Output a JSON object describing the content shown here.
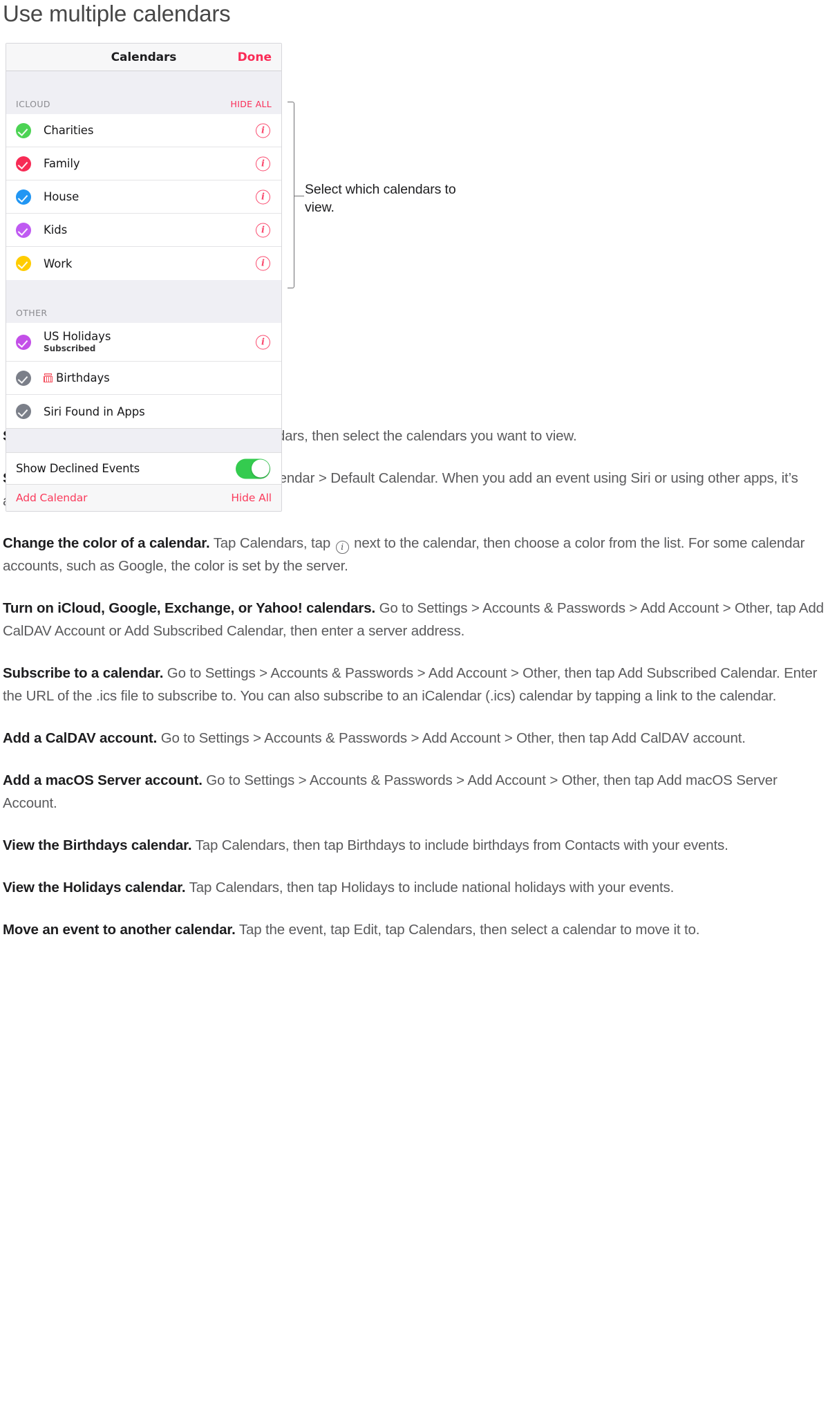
{
  "page": {
    "title": "Use multiple calendars"
  },
  "figure": {
    "callout": "Select which calendars to view.",
    "panel": {
      "navbar": {
        "title": "Calendars",
        "done_label": "Done"
      },
      "sections": [
        {
          "header": "ICLOUD",
          "action_label": "HIDE ALL",
          "rows": [
            {
              "label": "Charities",
              "checked": true,
              "color": "#4cd354",
              "info": true
            },
            {
              "label": "Family",
              "checked": true,
              "color": "#f72b55",
              "info": true
            },
            {
              "label": "House",
              "checked": true,
              "color": "#2196f3",
              "info": true
            },
            {
              "label": "Kids",
              "checked": true,
              "color": "#bf5af2",
              "info": true
            },
            {
              "label": "Work",
              "checked": true,
              "color": "#ffcc00",
              "info": true
            }
          ]
        },
        {
          "header": "OTHER",
          "action_label": "",
          "rows": [
            {
              "label": "US Holidays",
              "sublabel": "Subscribed",
              "checked": true,
              "color": "#c34fe8",
              "info": true
            },
            {
              "label": "Birthdays",
              "checked": true,
              "color": "#7b7f89",
              "info": false,
              "icon": "birthday-cake-icon"
            },
            {
              "label": "Siri Found in Apps",
              "checked": true,
              "color": "#7b7f89",
              "info": false
            }
          ]
        }
      ],
      "toggle_row": {
        "label": "Show Declined Events",
        "state": "on",
        "on_color": "#34cb4f"
      },
      "footer": {
        "add_label": "Add Calendar",
        "hide_label": "Hide All",
        "color": "#fa3b5c"
      }
    }
  },
  "tips": [
    {
      "heading": "See multiple calendars at once.",
      "body_before": " Tap Calendars, then select the calendars you want to view.",
      "has_info_icon": false,
      "body_after": ""
    },
    {
      "heading": "Set a default calendar.",
      "body_before": " Go to Settings > Calendar > Default Calendar. When you add an event using Siri or using other apps, it’s added to your default calendar.",
      "has_info_icon": false,
      "body_after": ""
    },
    {
      "heading": "Change the color of a calendar.",
      "body_before": " Tap Calendars, tap ",
      "has_info_icon": true,
      "body_after": " next to the calendar, then choose a color from the list. For some calendar accounts, such as Google, the color is set by the server."
    },
    {
      "heading": "Turn on iCloud, Google, Exchange, or Yahoo! calendars.",
      "body_before": " Go to Settings > Accounts & Passwords > Add Account > Other, tap Add CalDAV Account or Add Subscribed Calendar, then enter a server address.",
      "has_info_icon": false,
      "body_after": ""
    },
    {
      "heading": "Subscribe to a calendar.",
      "body_before": " Go to Settings > Accounts & Passwords > Add Account > Other, then tap Add Subscribed Calendar. Enter the URL of the .ics file to subscribe to. You can also subscribe to an iCalendar (.ics) calendar by tapping a link to the calendar.",
      "has_info_icon": false,
      "body_after": ""
    },
    {
      "heading": "Add a CalDAV account.",
      "body_before": " Go to Settings > Accounts & Passwords > Add Account > Other, then tap Add CalDAV account.",
      "has_info_icon": false,
      "body_after": ""
    },
    {
      "heading": "Add a macOS Server account.",
      "body_before": " Go to Settings > Accounts & Passwords > Add Account > Other, then tap Add macOS Server Account.",
      "has_info_icon": false,
      "body_after": ""
    },
    {
      "heading": "View the Birthdays calendar.",
      "body_before": " Tap Calendars, then tap Birthdays to include birthdays from Contacts with your events.",
      "has_info_icon": false,
      "body_after": ""
    },
    {
      "heading": "View the Holidays calendar.",
      "body_before": " Tap Calendars, then tap Holidays to include national holidays with your events.",
      "has_info_icon": false,
      "body_after": ""
    },
    {
      "heading": "Move an event to another calendar.",
      "body_before": " Tap the event, tap Edit, tap Calendars, then select a calendar to move it to.",
      "has_info_icon": false,
      "body_after": ""
    }
  ]
}
